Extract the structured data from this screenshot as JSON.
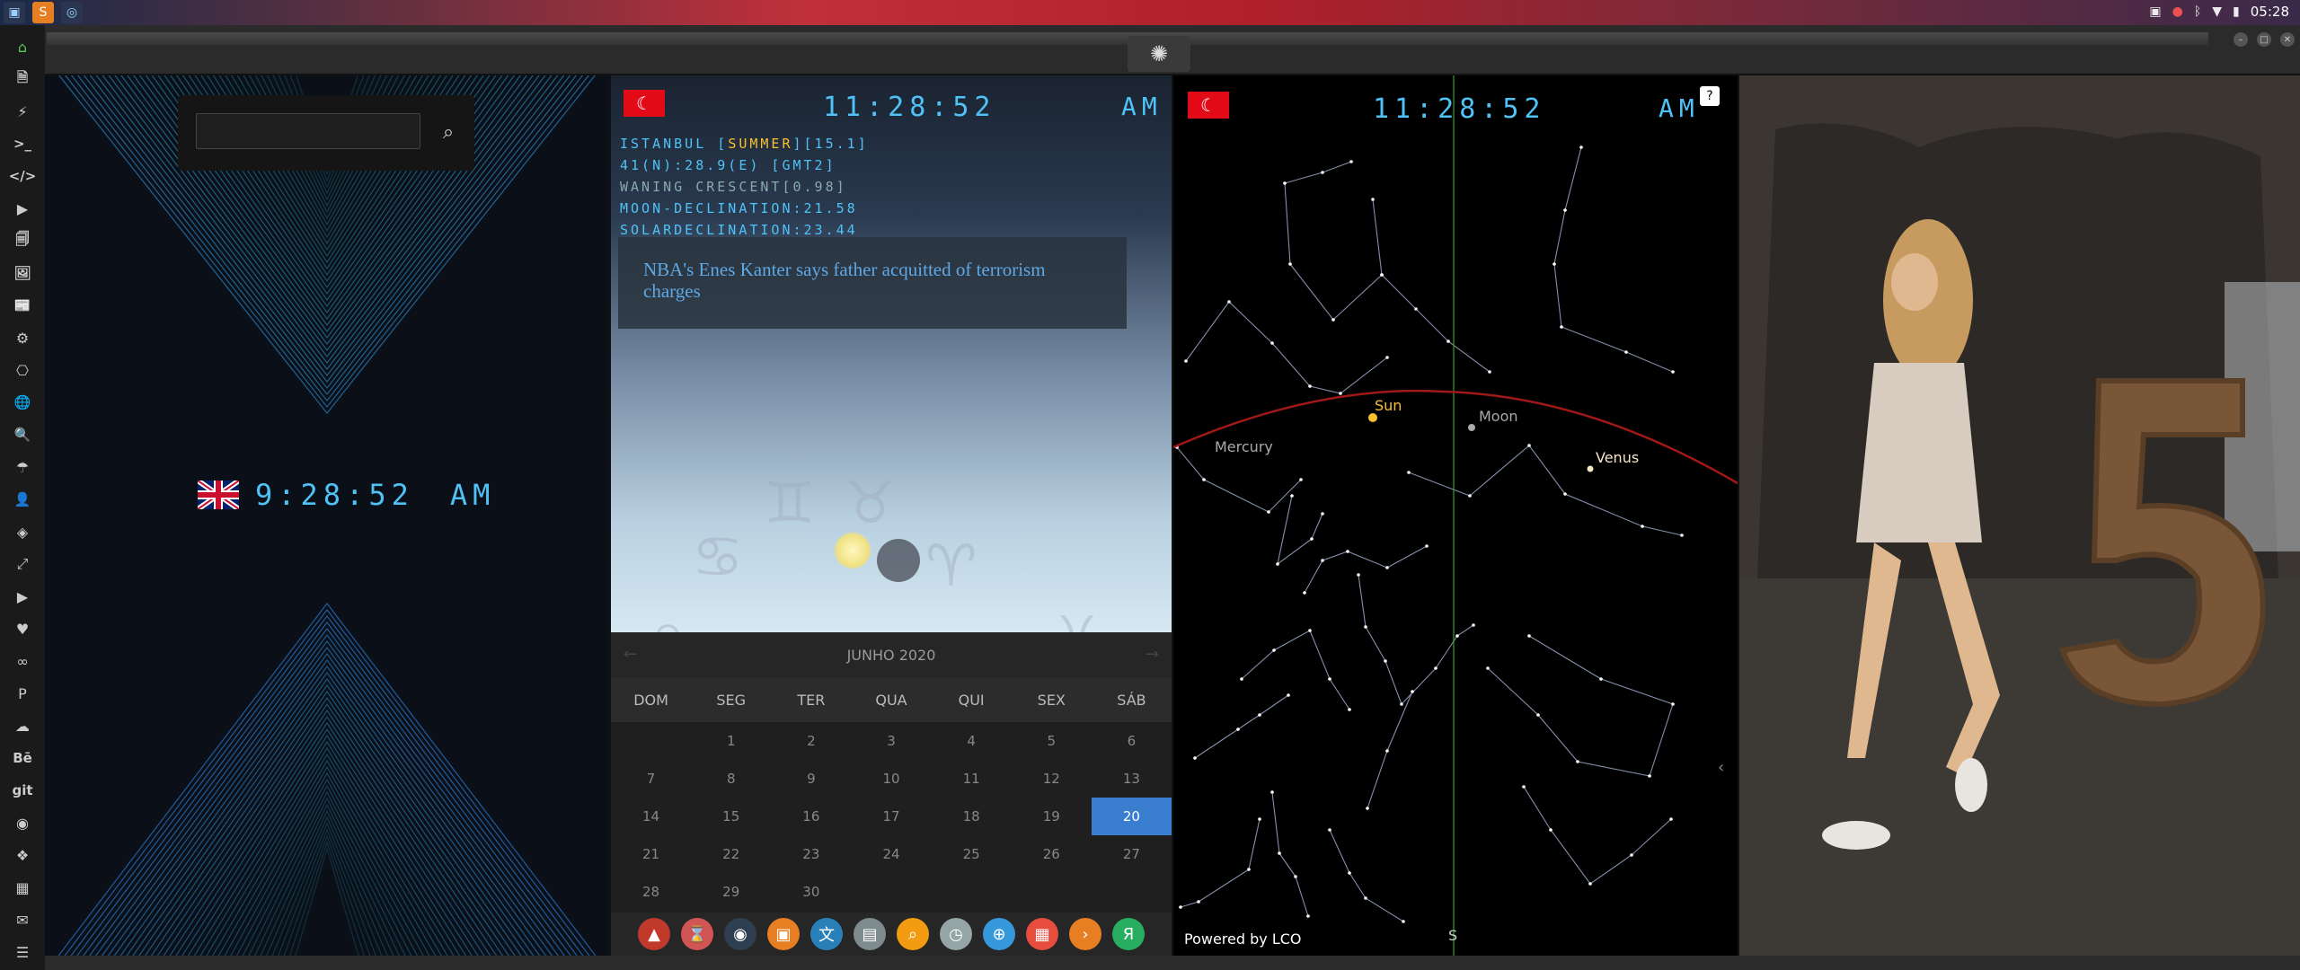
{
  "topbar": {
    "time": "05:28",
    "app_icons": [
      "files-icon",
      "sublime-icon",
      "app-icon"
    ],
    "tray_icons": [
      "image-icon",
      "record-icon",
      "bluetooth-icon",
      "wifi-icon",
      "battery-icon"
    ]
  },
  "window": {
    "logo_icon": "rebel-alliance-icon",
    "buttons": [
      "minimize",
      "maximize",
      "close"
    ]
  },
  "sidebar": {
    "items": [
      {
        "icon": "home-icon",
        "glyph": "⌂"
      },
      {
        "icon": "document-icon",
        "glyph": "🗎"
      },
      {
        "icon": "bolt-icon",
        "glyph": "⚡"
      },
      {
        "icon": "terminal-icon",
        "glyph": ">_"
      },
      {
        "icon": "code-icon",
        "glyph": "</>"
      },
      {
        "icon": "play-icon",
        "glyph": "▶"
      },
      {
        "icon": "pdf-icon",
        "glyph": "🗐"
      },
      {
        "icon": "image-icon",
        "glyph": "🖼"
      },
      {
        "icon": "newspaper-icon",
        "glyph": "📰"
      },
      {
        "icon": "settings-icon",
        "glyph": "⚙"
      },
      {
        "icon": "network-icon",
        "glyph": "⎔"
      },
      {
        "icon": "globe-icon",
        "glyph": "🌐"
      },
      {
        "icon": "search-icon",
        "glyph": "🔍"
      },
      {
        "icon": "umbrella-icon",
        "glyph": "☂"
      },
      {
        "icon": "contacts-icon",
        "glyph": "👤"
      },
      {
        "icon": "tag-icon",
        "glyph": "◈"
      },
      {
        "icon": "expand-icon",
        "glyph": "⤢"
      },
      {
        "icon": "youtube-icon",
        "glyph": "▶"
      },
      {
        "icon": "heart-icon",
        "glyph": "♥"
      },
      {
        "icon": "infinity-icon",
        "glyph": "∞"
      },
      {
        "icon": "pinterest-icon",
        "glyph": "P"
      },
      {
        "icon": "cloud-icon",
        "glyph": "☁"
      },
      {
        "icon": "behance-icon",
        "glyph": "Bē"
      },
      {
        "icon": "git-icon",
        "glyph": "git"
      },
      {
        "icon": "github-icon",
        "glyph": "◉"
      },
      {
        "icon": "puzzle-icon",
        "glyph": "❖"
      },
      {
        "icon": "map-icon",
        "glyph": "▦"
      },
      {
        "icon": "mail-icon",
        "glyph": "✉"
      },
      {
        "icon": "server-icon",
        "glyph": "☰"
      }
    ]
  },
  "uk_clock": {
    "time": "9:28:52",
    "ampm": "AM"
  },
  "istanbul": {
    "time": "11:28:52",
    "ampm": "AM",
    "info": {
      "line1_a": "ISTANBUL [",
      "line1_b": "SUMMER",
      "line1_c": "][15.1]",
      "line2": "41(N):28.9(E) [GMT2]",
      "line3": "WANING CRESCENT[0.98]",
      "line4": "MOON-DECLINATION:21.58",
      "line5": "SOLARDECLINATION:23.44"
    },
    "news": "NBA's Enes Kanter says father acquitted of terrorism charges"
  },
  "calendar": {
    "month": "JUNHO 2020",
    "weekdays": [
      "DOM",
      "SEG",
      "TER",
      "QUA",
      "QUI",
      "SEX",
      "SÁB"
    ],
    "days": [
      "",
      "1",
      "2",
      "3",
      "4",
      "5",
      "6",
      "7",
      "8",
      "9",
      "10",
      "11",
      "12",
      "13",
      "14",
      "15",
      "16",
      "17",
      "18",
      "19",
      "20",
      "21",
      "22",
      "23",
      "24",
      "25",
      "26",
      "27",
      "28",
      "29",
      "30"
    ],
    "selected": "20"
  },
  "dock": {
    "items": [
      {
        "name": "app-red-icon",
        "color": "#c0392b",
        "glyph": "▲"
      },
      {
        "name": "hourglass-icon",
        "color": "#d35454",
        "glyph": "⌛"
      },
      {
        "name": "globe-dark-icon",
        "color": "#2c3e50",
        "glyph": "◉"
      },
      {
        "name": "photos-icon",
        "color": "#e67e22",
        "glyph": "▣"
      },
      {
        "name": "translate-icon",
        "color": "#2980b9",
        "glyph": "文"
      },
      {
        "name": "browser-icon",
        "color": "#7f8c8d",
        "glyph": "▤"
      },
      {
        "name": "search-app-icon",
        "color": "#f39c12",
        "glyph": "⌕"
      },
      {
        "name": "clock-icon",
        "color": "#95a5a6",
        "glyph": "◷"
      },
      {
        "name": "web-icon",
        "color": "#3498db",
        "glyph": "⊕"
      },
      {
        "name": "calendar-app-icon",
        "color": "#e74c3c",
        "glyph": "▦"
      },
      {
        "name": "arrow-app-icon",
        "color": "#e67e22",
        "glyph": "›"
      },
      {
        "name": "yandex-icon",
        "color": "#27ae60",
        "glyph": "Я"
      }
    ]
  },
  "skymap": {
    "time": "11:28:52",
    "ampm": "AM",
    "help": "?",
    "labels": {
      "sun": "Sun",
      "moon": "Moon",
      "mercury": "Mercury",
      "venus": "Venus",
      "south": "S"
    },
    "powered": "Powered by LCO"
  },
  "colors": {
    "accent": "#4fc3f7",
    "selected_day": "#3a7ed0",
    "news_text": "#5ea8e6",
    "ecliptic": "#a01818"
  }
}
